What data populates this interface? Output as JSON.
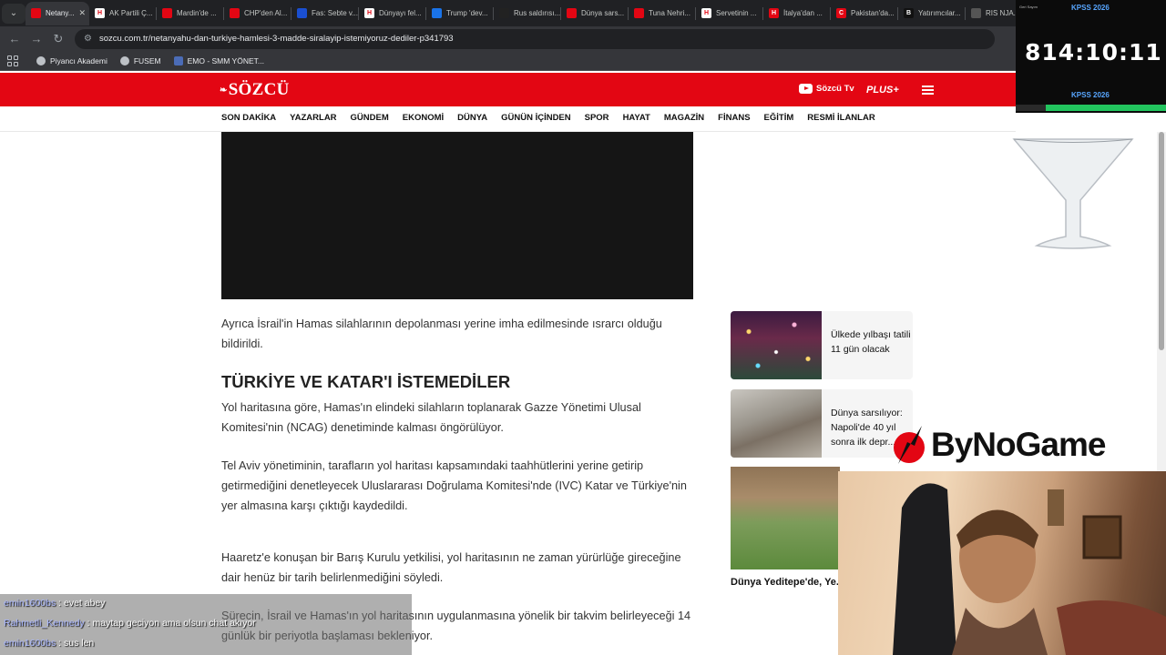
{
  "browser": {
    "tabs": [
      {
        "label": "Netany...",
        "favicon_color": "#e30613",
        "favicon_text": "",
        "active": true
      },
      {
        "label": "AK Partili Ç...",
        "favicon_color": "#ffffff",
        "favicon_text": "H"
      },
      {
        "label": "Mardin'de ...",
        "favicon_color": "#e30613",
        "favicon_text": ""
      },
      {
        "label": "CHP'den Al...",
        "favicon_color": "#e30613",
        "favicon_text": ""
      },
      {
        "label": "Fas: Sebte v...",
        "favicon_color": "#1a4fd1",
        "favicon_text": ""
      },
      {
        "label": "Dünyayı fel...",
        "favicon_color": "#ffffff",
        "favicon_text": "H"
      },
      {
        "label": "Trump 'dev...",
        "favicon_color": "#1a73e8",
        "favicon_text": ""
      },
      {
        "label": "Rus saldırısı...",
        "favicon_color": "#222222",
        "favicon_text": ""
      },
      {
        "label": "Dünya sars...",
        "favicon_color": "#e30613",
        "favicon_text": ""
      },
      {
        "label": "Tuna Nehri...",
        "favicon_color": "#e30613",
        "favicon_text": ""
      },
      {
        "label": "Servetinin ...",
        "favicon_color": "#ffffff",
        "favicon_text": "H"
      },
      {
        "label": "İtalya'dan ...",
        "favicon_color": "#e30613",
        "favicon_text": "H"
      },
      {
        "label": "Pakistan'da...",
        "favicon_color": "#e30613",
        "favicon_text": "C"
      },
      {
        "label": "Yatırımcılar...",
        "favicon_color": "#111111",
        "favicon_text": "B"
      },
      {
        "label": "RIS NJA...",
        "favicon_color": "#555555",
        "favicon_text": ""
      }
    ],
    "url": "sozcu.com.tr/netanyahu-dan-turkiye-hamlesi-3-madde-siralayip-istemiyoruz-dediler-p341793",
    "bookmarks": [
      "Piyancı Akademi",
      "FUSEM",
      "EMO - SMM YÖNET..."
    ]
  },
  "site": {
    "logo": "SÖZCÜ",
    "tv_label": "Sözcü Tv",
    "plus_label": "PLUS+",
    "nav": [
      "SON DAKİKA",
      "YAZARLAR",
      "GÜNDEM",
      "EKONOMİ",
      "DÜNYA",
      "GÜNÜN İÇİNDEN",
      "SPOR",
      "HAYAT",
      "MAGAZİN",
      "FİNANS",
      "EĞİTİM",
      "RESMİ İLANLAR"
    ]
  },
  "article": {
    "para1": "Ayrıca İsrail'in Hamas silahlarının depolanması yerine imha edilmesinde ısrarcı olduğu bildirildi.",
    "heading": "TÜRKİYE VE KATAR'I İSTEMEDİLER",
    "para2": "Yol haritasına göre, Hamas'ın elindeki silahların toplanarak Gazze Yönetimi Ulusal Komitesi'nin (NCAG) denetiminde kalması öngörülüyor.",
    "para3": "Tel Aviv yönetiminin, tarafların yol haritası kapsamındaki taahhütlerini yerine getirip getirmediğini denetleyecek Uluslararası Doğrulama Komitesi'nde (IVC) Katar ve Türkiye'nin yer almasına karşı çıktığı kaydedildi.",
    "para4": "Haaretz'e konuşan bir Barış Kurulu yetkilisi, yol haritasının ne zaman yürürlüğe gireceğine dair henüz bir tarih belirlenmediğini söyledi.",
    "para5": "Sürecin, İsrail ve Hamas'ın yol haritasının uygulanmasına yönelik bir takvim belirleyeceği 14 günlük bir periyotla başlaması bekleniyor."
  },
  "sidebar": {
    "cards": [
      {
        "title": "Ülkede yılbaşı tatili 11 gün olacak"
      },
      {
        "title": "Dünya sarsılıyor: Napoli'de 40 yıl sonra ilk depr..."
      }
    ],
    "big_card_title": "Dünya Yeditepe'de, Ye... Dünyada"
  },
  "overlay": {
    "timer_label_top": "KPSS 2026",
    "timer_small": "Geri Sayım",
    "timer_value": "814:10:11",
    "timer_label_bottom": "KPSS 2026",
    "timer_progress": 0.8,
    "sponsor": "ByNoGame",
    "chat": [
      {
        "user": "emin1600bs",
        "message": ": evet abey"
      },
      {
        "user": "Rahmetli_Kennedy",
        "message": ": maytap geciyon ama olsun chat akıyor"
      },
      {
        "user": "emin1600bs",
        "message": ": sus len"
      }
    ]
  },
  "colors": {
    "brand_red": "#e30613",
    "chrome_dark": "#202124",
    "chrome_mid": "#35363a",
    "timer_blue": "#58a6ff",
    "progress_green": "#22c55e"
  }
}
